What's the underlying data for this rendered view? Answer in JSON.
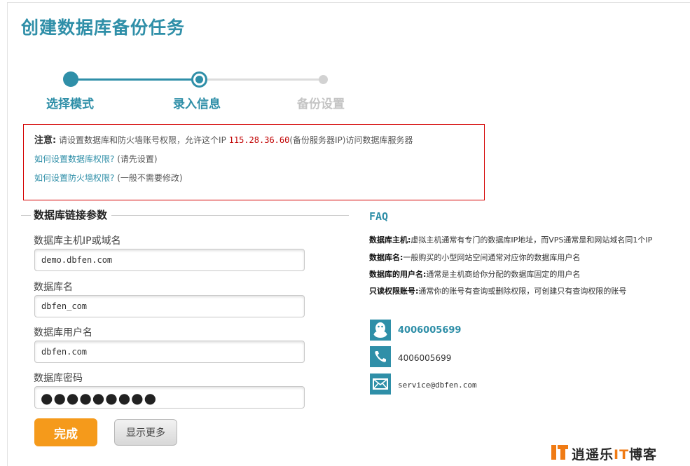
{
  "page": {
    "title": "创建数据库备份任务"
  },
  "stepper": {
    "steps": [
      {
        "label": "选择模式"
      },
      {
        "label": "录入信息"
      },
      {
        "label": "备份设置"
      }
    ]
  },
  "notice": {
    "label": "注意:",
    "text_before_ip": "请设置数据库和防火墙账号权限，允许这个IP",
    "ip": "115.28.36.60",
    "text_after_ip": "(备份服务器IP)访问数据库服务器",
    "link1": "如何设置数据库权限?",
    "link1_note": "(请先设置)",
    "link2": "如何设置防火墙权限?",
    "link2_note": "(一般不需要修改)"
  },
  "form": {
    "section_title": "数据库链接参数",
    "host_label": "数据库主机IP或域名",
    "host_value": "demo.dbfen.com",
    "dbname_label": "数据库名",
    "dbname_value": "dbfen_com",
    "user_label": "数据库用户名",
    "user_value": "dbfen.com",
    "password_label": "数据库密码",
    "password_mask": "●●●●●●●●●",
    "done_button": "完成",
    "more_button": "显示更多"
  },
  "faq": {
    "title": "FAQ",
    "items": [
      {
        "term": "数据库主机:",
        "desc": "虚拟主机通常有专门的数据库IP地址，而VPS通常是和网站域名同1个IP"
      },
      {
        "term": "数据库名:",
        "desc": "一般购买的小型网站空间通常对应你的数据库用户名"
      },
      {
        "term": "数据库的用户名:",
        "desc": "通常是主机商给你分配的数据库固定的用户名"
      },
      {
        "term": "只读权限账号:",
        "desc": "通常你的账号有查询或删除权限，可创建只有查询权限的账号"
      }
    ]
  },
  "contact": {
    "qq": "4006005699",
    "phone": "4006005699",
    "email": "service@dbfen.com"
  },
  "logo": {
    "text_before": "逍遥乐",
    "text_it": "IT",
    "text_after": "博客"
  },
  "colors": {
    "accent": "#2f8fa8",
    "notice_border": "#d40000",
    "ip_text": "#c00000",
    "done_button": "#f59a1b",
    "logo_orange": "#f07b14"
  },
  "icons": {
    "qq": "qq-penguin-icon",
    "phone": "phone-icon",
    "email": "envelope-icon",
    "logo": "it-logo-icon"
  }
}
